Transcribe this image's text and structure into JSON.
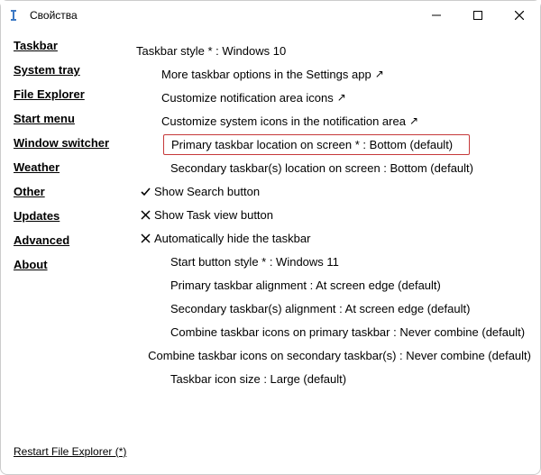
{
  "window": {
    "title": "Свойства"
  },
  "sidebar": {
    "items": [
      {
        "label": "Taskbar"
      },
      {
        "label": "System tray"
      },
      {
        "label": "File Explorer"
      },
      {
        "label": "Start menu"
      },
      {
        "label": "Window switcher"
      },
      {
        "label": "Weather"
      },
      {
        "label": "Other"
      },
      {
        "label": "Updates"
      },
      {
        "label": "Advanced"
      },
      {
        "label": "About"
      }
    ],
    "footer": "Restart File Explorer (*)"
  },
  "settings": {
    "taskbar_style": "Taskbar style * : Windows 10",
    "more_options": "More taskbar options in the Settings app",
    "customize_notif_icons": "Customize notification area icons",
    "customize_sys_icons": "Customize system icons in the notification area",
    "primary_location": "Primary taskbar location on screen * : Bottom (default)",
    "secondary_location": "Secondary taskbar(s) location on screen : Bottom (default)",
    "show_search": "Show Search button",
    "show_taskview": "Show Task view button",
    "auto_hide": "Automatically hide the taskbar",
    "start_button_style": "Start button style * : Windows 11",
    "primary_align": "Primary taskbar alignment : At screen edge (default)",
    "secondary_align": "Secondary taskbar(s) alignment : At screen edge (default)",
    "combine_primary": "Combine taskbar icons on primary taskbar : Never combine (default)",
    "combine_secondary": "Combine taskbar icons on secondary taskbar(s) : Never combine (default)",
    "icon_size": "Taskbar icon size : Large (default)"
  },
  "glyphs": {
    "link_arrow": "↗"
  }
}
